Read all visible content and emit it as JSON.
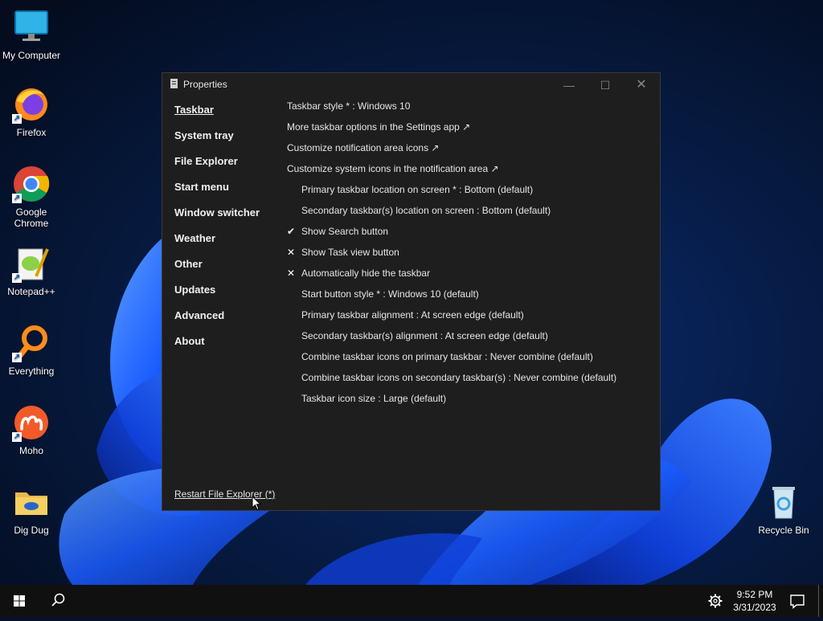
{
  "desktop": {
    "icons": [
      {
        "label": "My Computer"
      },
      {
        "label": "Firefox"
      },
      {
        "label": "Google Chrome"
      },
      {
        "label": "Notepad++"
      },
      {
        "label": "Everything"
      },
      {
        "label": "Moho"
      },
      {
        "label": "Dig Dug"
      },
      {
        "label": "Recycle Bin"
      }
    ]
  },
  "window": {
    "title": "Properties",
    "controls": {
      "minimize": "—",
      "maximize": "☐",
      "close": "✕"
    },
    "nav": [
      {
        "label": "Taskbar",
        "active": true
      },
      {
        "label": "System tray"
      },
      {
        "label": "File Explorer"
      },
      {
        "label": "Start menu"
      },
      {
        "label": "Window switcher"
      },
      {
        "label": "Weather"
      },
      {
        "label": "Other"
      },
      {
        "label": "Updates"
      },
      {
        "label": "Advanced"
      },
      {
        "label": "About"
      }
    ],
    "settings": [
      {
        "text": "Taskbar style * : Windows 10"
      },
      {
        "text": "More taskbar options in the Settings app ↗"
      },
      {
        "text": "Customize notification area icons ↗"
      },
      {
        "text": "Customize system icons in the notification area ↗"
      },
      {
        "text": "Primary taskbar location on screen * : Bottom (default)"
      },
      {
        "text": "Secondary taskbar(s) location on screen : Bottom (default)"
      },
      {
        "text": "Show Search button",
        "mark": "✔"
      },
      {
        "text": "Show Task view button",
        "mark": "✕"
      },
      {
        "text": "Automatically hide the taskbar",
        "mark": "✕"
      },
      {
        "text": "Start button style * : Windows 10 (default)"
      },
      {
        "text": "Primary taskbar alignment : At screen edge (default)"
      },
      {
        "text": "Secondary taskbar(s) alignment : At screen edge (default)"
      },
      {
        "text": "Combine taskbar icons on primary taskbar : Never combine (default)"
      },
      {
        "text": "Combine taskbar icons on secondary taskbar(s) : Never combine (default)"
      },
      {
        "text": "Taskbar icon size : Large (default)"
      }
    ],
    "restart_label": "Restart File Explorer (*)"
  },
  "taskbar": {
    "time": "9:52 PM",
    "date": "3/31/2023"
  },
  "colors": {
    "window_bg": "#1e1e1e",
    "taskbar_bg": "#101010",
    "wallpaper_accent": "#1a5cff"
  }
}
